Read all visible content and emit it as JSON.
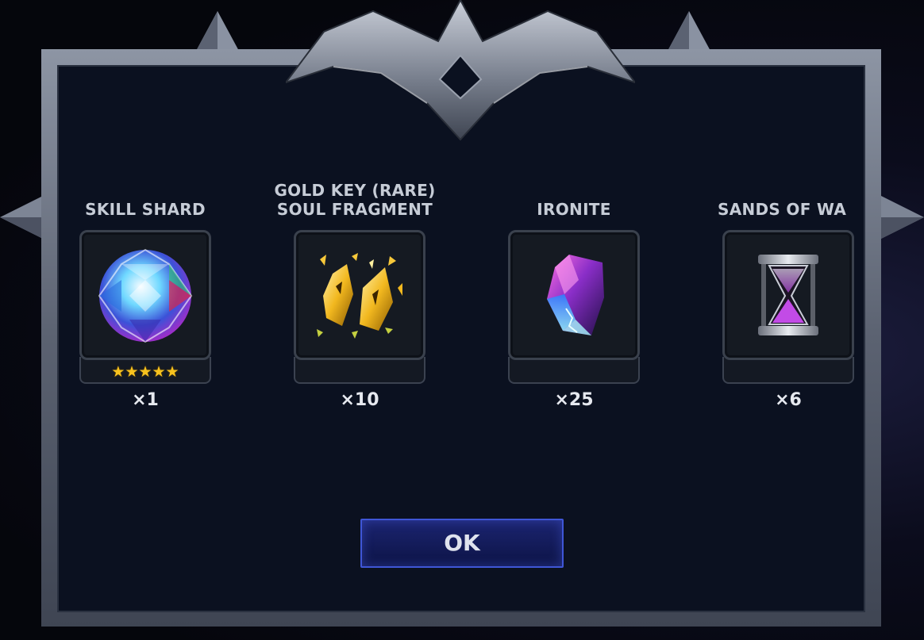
{
  "rewards": [
    {
      "title": "SKILL SHARD",
      "quantity": "×1",
      "stars": "★★★★★",
      "icon": "skill-shard-gem-icon"
    },
    {
      "title": "GOLD KEY (RARE)\nSOUL FRAGMENT",
      "quantity": "×10",
      "stars": "",
      "icon": "gold-key-soul-fragment-icon"
    },
    {
      "title": "IRONITE",
      "quantity": "×25",
      "stars": "",
      "icon": "ironite-crystal-icon"
    },
    {
      "title": "SANDS OF WA",
      "quantity": "×6",
      "stars": "",
      "icon": "hourglass-icon"
    }
  ],
  "ok_label": "OK",
  "colors": {
    "button_border": "#3f56d6",
    "star": "#f7c21e",
    "panel": "#0b1120"
  }
}
